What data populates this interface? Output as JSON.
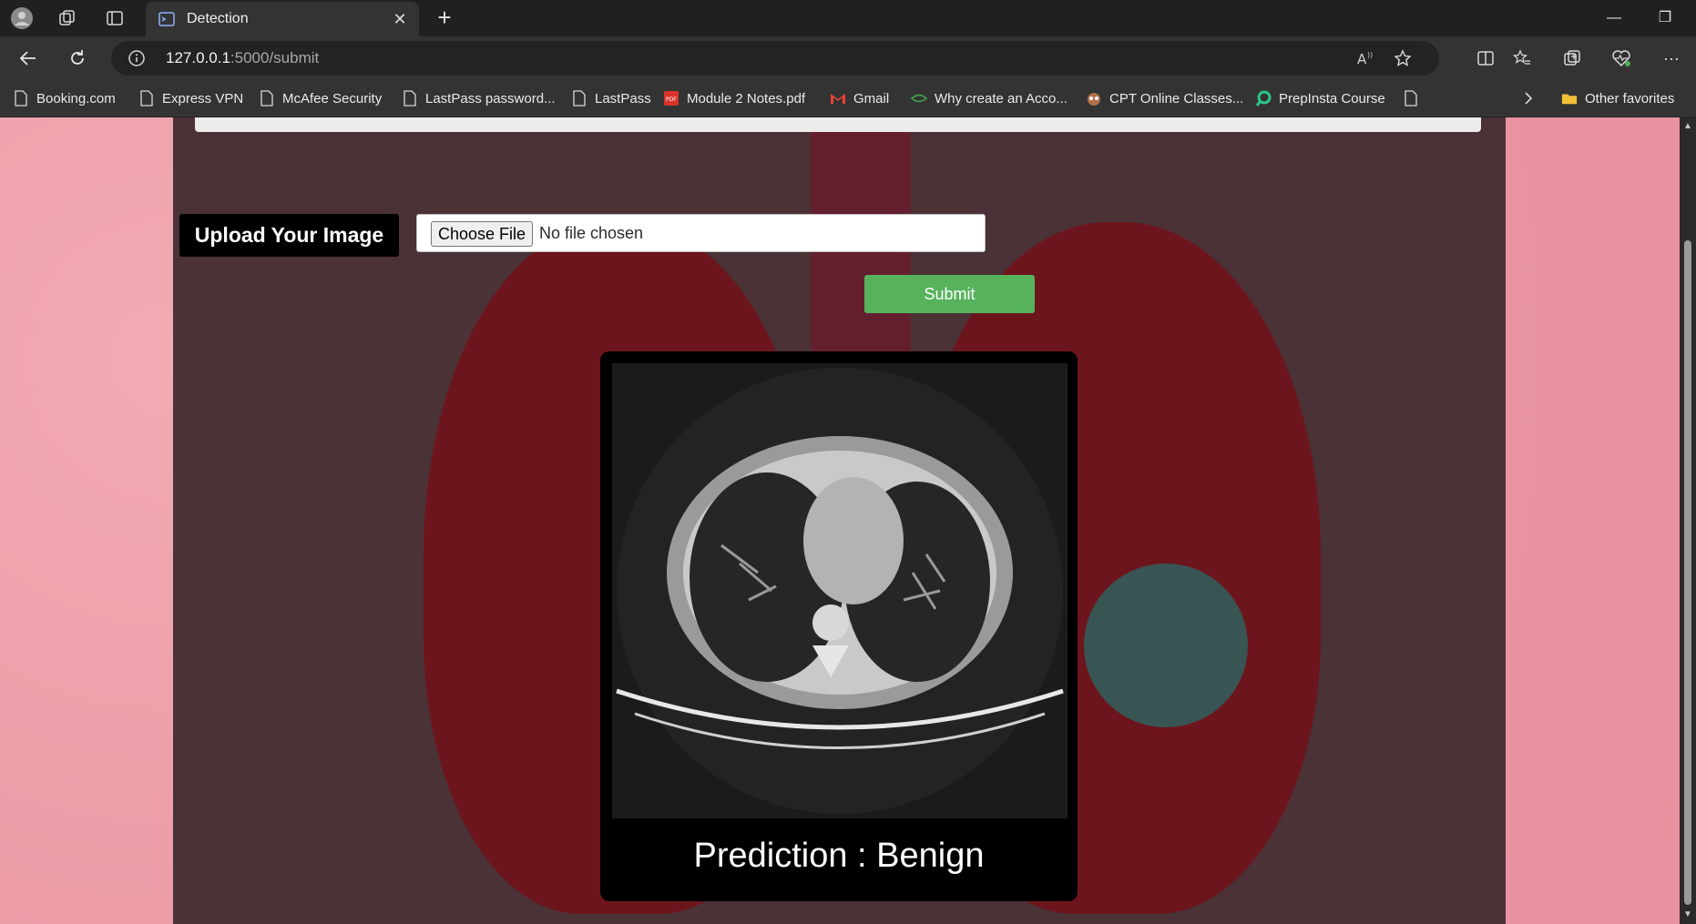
{
  "tab": {
    "title": "Detection",
    "close": "✕",
    "new_tab": "+"
  },
  "window": {
    "minimize": "—",
    "restore": "❐"
  },
  "nav": {
    "url_host": "127.0.0.1",
    "url_rest": ":5000/submit",
    "menu": "···"
  },
  "bookmarks": [
    {
      "label": "Booking.com",
      "icon": "page-icon"
    },
    {
      "label": "Express VPN",
      "icon": "page-icon"
    },
    {
      "label": "McAfee Security",
      "icon": "page-icon"
    },
    {
      "label": "LastPass password...",
      "icon": "page-icon"
    },
    {
      "label": "LastPass",
      "icon": "page-icon"
    },
    {
      "label": "Module 2 Notes.pdf",
      "icon": "pdf-icon"
    },
    {
      "label": "Gmail",
      "icon": "gmail-icon"
    },
    {
      "label": "Why create an Acco...",
      "icon": "leaf-icon"
    },
    {
      "label": "CPT Online Classes...",
      "icon": "owl-icon"
    },
    {
      "label": "PrepInsta Course",
      "icon": "prepinsta-icon"
    }
  ],
  "other_favorites": "Other favorites",
  "page": {
    "upload_label": "Upload Your Image",
    "choose_file": "Choose File",
    "no_file": "No file chosen",
    "submit": "Submit",
    "prediction": "Prediction : Benign"
  },
  "colors": {
    "submit_green": "#56b35c",
    "page_bg": "#4a3236",
    "side_pink": "#ec9aa4"
  }
}
